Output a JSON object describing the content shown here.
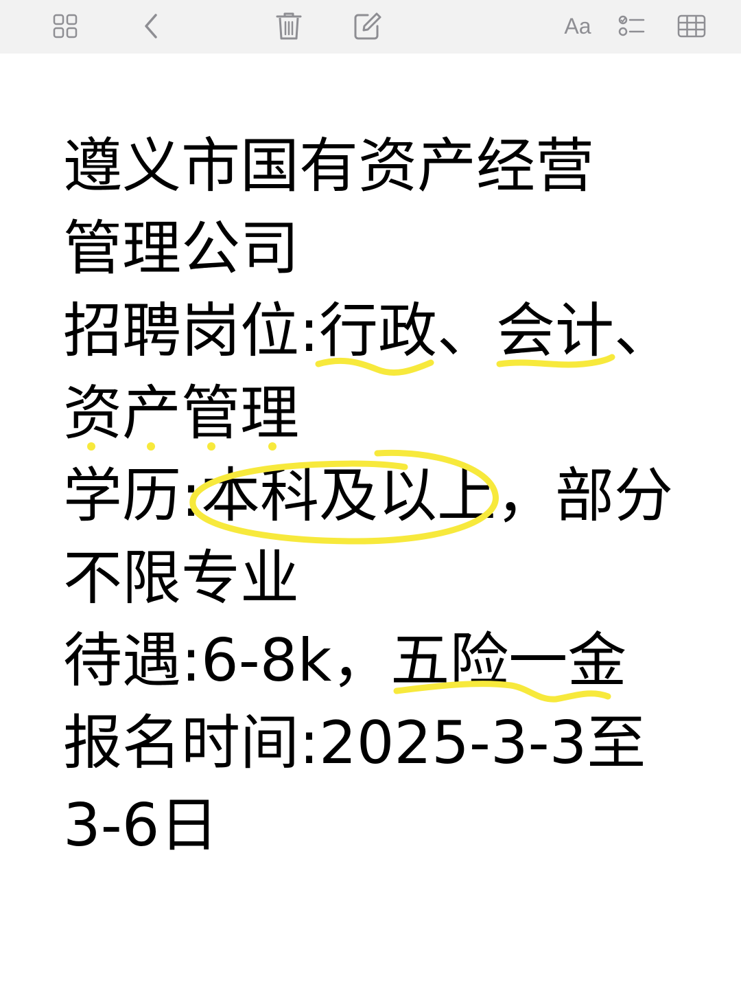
{
  "toolbar": {
    "buttons": [
      {
        "id": "gallery",
        "icon": "grid-view-icon"
      },
      {
        "id": "back",
        "icon": "chevron-left-icon"
      },
      {
        "id": "delete",
        "icon": "trash-icon"
      },
      {
        "id": "compose",
        "icon": "compose-icon"
      },
      {
        "id": "format",
        "icon": "text-format-icon",
        "label": "Aa"
      },
      {
        "id": "checklist",
        "icon": "checklist-icon"
      },
      {
        "id": "table",
        "icon": "table-icon"
      }
    ]
  },
  "note": {
    "title_line1": "遵义市国有资产经营",
    "title_line2": "管理公司",
    "positions_label": "招聘岗位:",
    "positions_1": "行政",
    "sep1": "、",
    "positions_2": "会计",
    "sep2": "、",
    "positions_3": "资产管理",
    "education_label": "学历:",
    "education_value": "本科及以上",
    "education_rest": "，部分",
    "education_line2": "不限专业",
    "salary_label": "待遇:",
    "salary_value": "6-8k，",
    "salary_benefits": "五险一金",
    "signup_label": "报名时间:",
    "signup_value_1": "2025-3-3至",
    "signup_value_2": "3-6日"
  },
  "colors": {
    "toolbar_bg": "#f2f2f2",
    "icon_gray": "#8e8e93",
    "highlight_yellow": "#f7e93c",
    "text": "#000000"
  }
}
